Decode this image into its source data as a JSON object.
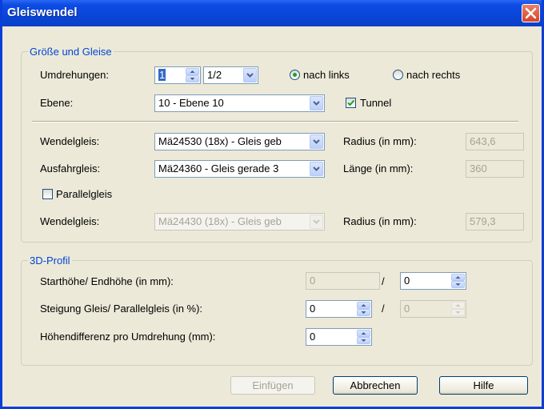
{
  "window": {
    "title": "Gleiswendel"
  },
  "groups": {
    "size": {
      "legend": "Größe und Gleise",
      "rotations": {
        "label": "Umdrehungen:",
        "value": "1",
        "fraction": "1/2"
      },
      "direction": {
        "left": "nach links",
        "right": "nach rechts",
        "selected": "left"
      },
      "level": {
        "label": "Ebene:",
        "value": "10 - Ebene 10"
      },
      "tunnel": {
        "label": "Tunnel",
        "checked": true
      },
      "spiral_track": {
        "label": "Wendelgleis:",
        "value": "Mä24530 (18x) - Gleis geb",
        "radius_label": "Radius (in mm):",
        "radius": "643,6"
      },
      "exit_track": {
        "label": "Ausfahrgleis:",
        "value": "Mä24360 - Gleis gerade 3",
        "length_label": "Länge (in mm):",
        "length": "360"
      },
      "parallel": {
        "label": "Parallelgleis",
        "checked": false
      },
      "parallel_spiral": {
        "label": "Wendelgleis:",
        "value": "Mä24430 (18x) - Gleis geb",
        "radius_label": "Radius (in mm):",
        "radius": "579,3"
      }
    },
    "profile": {
      "legend": "3D-Profil",
      "start_end": {
        "label": "Starthöhe/ Endhöhe (in mm):",
        "start": "0",
        "end": "0"
      },
      "slope": {
        "label": "Steigung Gleis/ Parallelgleis (in %):",
        "track": "0",
        "parallel": "0"
      },
      "height_diff": {
        "label": "Höhendifferenz pro Umdrehung (mm):",
        "value": "0"
      },
      "slash": "/"
    }
  },
  "buttons": {
    "insert": "Einfügen",
    "cancel": "Abbrechen",
    "help": "Hilfe"
  },
  "colors": {
    "titlebar": "#0a45d8",
    "close": "#d5432a",
    "legend": "#0046d5",
    "radio_dot": "#21a121",
    "check_mark": "#21a121"
  },
  "icons": {
    "close": "close-icon",
    "check": "checkmark-icon",
    "combo": "chevron-down-icon",
    "spin": "spin-arrows-icon"
  }
}
